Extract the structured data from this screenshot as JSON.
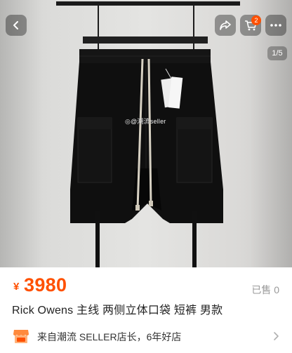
{
  "navigation": {
    "back_icon": "chevron-left-icon",
    "share_icon": "share-icon",
    "cart_icon": "shopping-cart-icon",
    "more_icon": "more-dots-icon",
    "cart_badge_count": "2",
    "page_indicator": "1/5"
  },
  "photo": {
    "watermark_text": "@潮流seller",
    "watermark_icon": "weibo-icon"
  },
  "product": {
    "currency_symbol": "¥",
    "price": "3980",
    "sold_label": "已售 0",
    "title": "Rick Owens 主线 两侧立体口袋 短裤 男款"
  },
  "store": {
    "icon": "shop-icon",
    "text": "来自潮流 SELLER店长，6年好店",
    "chevron_icon": "chevron-right-icon"
  },
  "colors": {
    "accent": "#ff5000",
    "muted": "#999999",
    "text": "#222222"
  }
}
